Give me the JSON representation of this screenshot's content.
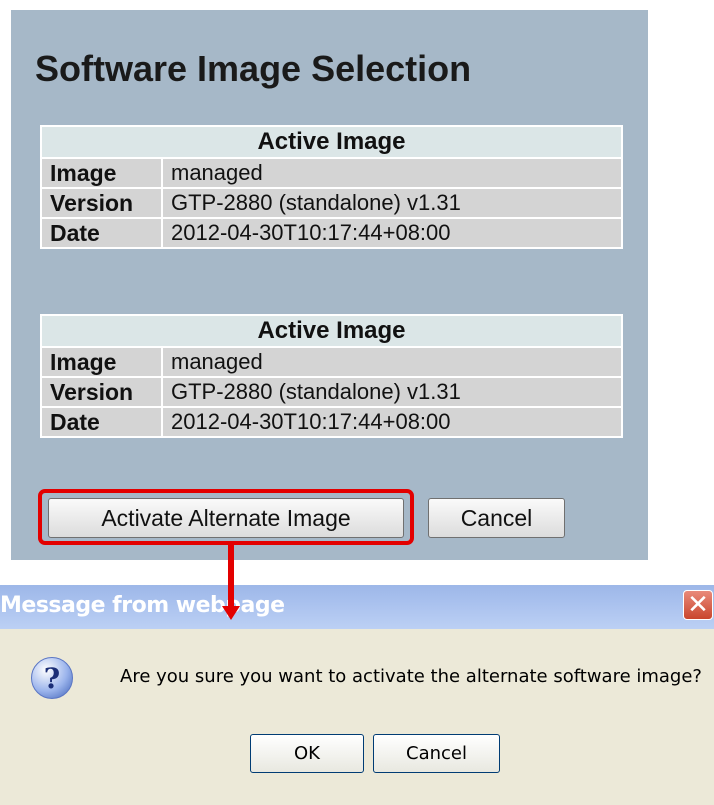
{
  "page": {
    "title": "Software Image Selection"
  },
  "tables": [
    {
      "header": "Active Image",
      "rows": [
        {
          "label": "Image",
          "value": "managed"
        },
        {
          "label": "Version",
          "value": "GTP-2880 (standalone) v1.31"
        },
        {
          "label": "Date",
          "value": "2012-04-30T10:17:44+08:00"
        }
      ]
    },
    {
      "header": "Active Image",
      "rows": [
        {
          "label": "Image",
          "value": "managed"
        },
        {
          "label": "Version",
          "value": "GTP-2880 (standalone) v1.31"
        },
        {
          "label": "Date",
          "value": "2012-04-30T10:17:44+08:00"
        }
      ]
    }
  ],
  "buttons": {
    "activate": "Activate Alternate Image",
    "cancel": "Cancel"
  },
  "dialog": {
    "title": "Message from webpage",
    "close_glyph": "✕",
    "icon": "question-icon",
    "message": "Are you sure you want to activate the alternate software image?",
    "ok": "OK",
    "cancel": "Cancel"
  },
  "colors": {
    "panel_bg": "#a6b8c8",
    "highlight": "#e30000",
    "dialog_bg": "#ece9d8"
  }
}
